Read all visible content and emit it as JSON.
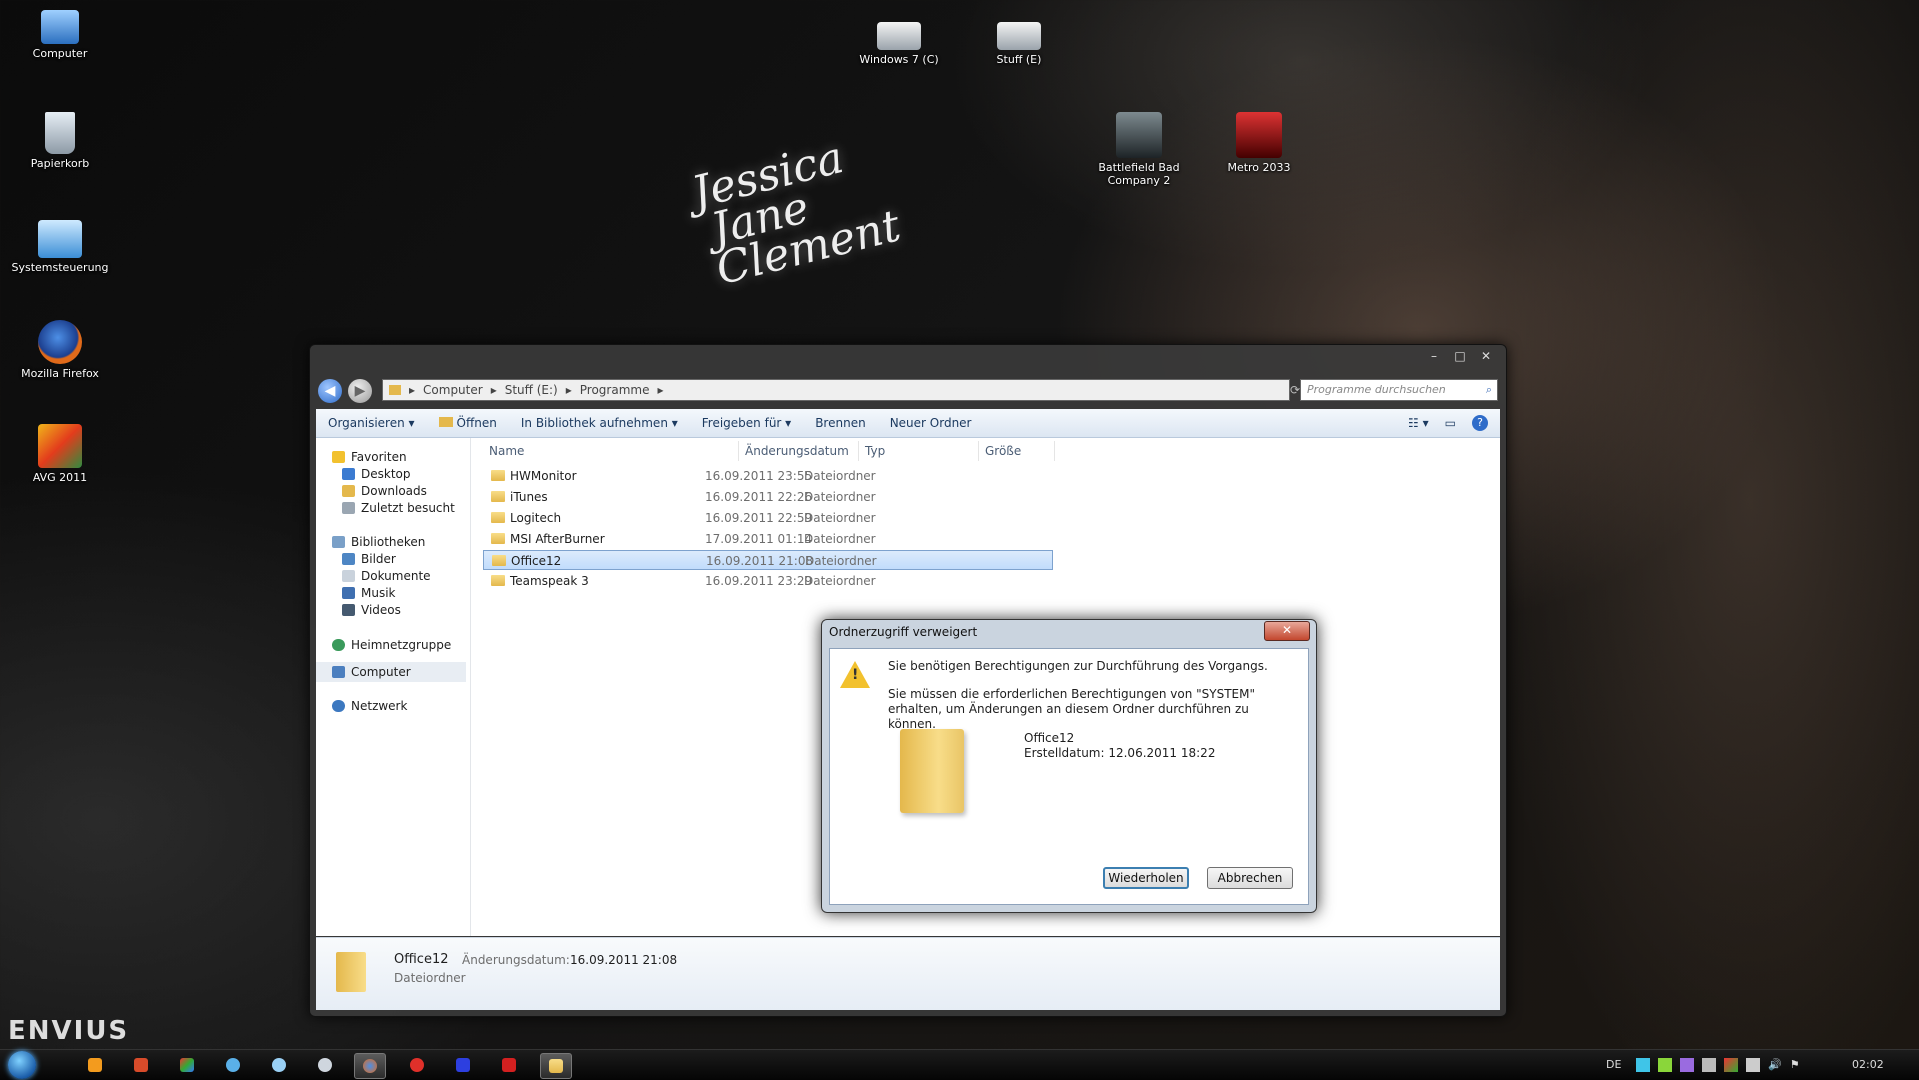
{
  "desktop": {
    "icons_left": [
      {
        "label": "Computer"
      },
      {
        "label": "Papierkorb"
      },
      {
        "label": "Systemsteuerung"
      },
      {
        "label": "Mozilla Firefox"
      },
      {
        "label": "AVG 2011"
      }
    ],
    "icons_top": [
      {
        "label": "Windows 7 (C)"
      },
      {
        "label": "Stuff (E)"
      }
    ],
    "icons_right": [
      {
        "label": "Battlefield Bad Company 2"
      },
      {
        "label": "Metro 2033"
      }
    ],
    "wallpaper_text": {
      "line1": "Jessica",
      "line2": "Jane",
      "line3": "Clement"
    },
    "brand": "ENVIUS"
  },
  "explorer": {
    "window_controls": {
      "minimize": "–",
      "maximize": "□",
      "close": "✕"
    },
    "address": {
      "part1": "Computer",
      "part2": "Stuff (E:)",
      "part3": "Programme",
      "sep": "▸"
    },
    "search": {
      "placeholder": "Programme durchsuchen"
    },
    "toolbar": {
      "organize": "Organisieren ▾",
      "open": "Öffnen",
      "library": "In Bibliothek aufnehmen ▾",
      "share": "Freigeben für ▾",
      "burn": "Brennen",
      "new_folder": "Neuer Ordner"
    },
    "sidebar": {
      "favorites": "Favoriten",
      "desktop": "Desktop",
      "downloads": "Downloads",
      "recent": "Zuletzt besucht",
      "libraries": "Bibliotheken",
      "pictures": "Bilder",
      "documents": "Dokumente",
      "music": "Musik",
      "videos": "Videos",
      "homegroup": "Heimnetzgruppe",
      "computer": "Computer",
      "network": "Netzwerk"
    },
    "columns": {
      "name": "Name",
      "date": "Änderungsdatum",
      "type": "Typ",
      "size": "Größe"
    },
    "rows": [
      {
        "name": "HWMonitor",
        "date": "16.09.2011 23:55",
        "type": "Dateiordner"
      },
      {
        "name": "iTunes",
        "date": "16.09.2011 22:26",
        "type": "Dateiordner"
      },
      {
        "name": "Logitech",
        "date": "16.09.2011 22:59",
        "type": "Dateiordner"
      },
      {
        "name": "MSI AfterBurner",
        "date": "17.09.2011 01:14",
        "type": "Dateiordner"
      },
      {
        "name": "Office12",
        "date": "16.09.2011 21:08",
        "type": "Dateiordner",
        "selected": true
      },
      {
        "name": "Teamspeak 3",
        "date": "16.09.2011 23:29",
        "type": "Dateiordner"
      }
    ],
    "details": {
      "name": "Office12",
      "modified_label": "Änderungsdatum:",
      "modified": "16.09.2011 21:08",
      "type": "Dateiordner"
    }
  },
  "dialog": {
    "title": "Ordnerzugriff verweigert",
    "close": "✕",
    "message1": "Sie benötigen Berechtigungen zur Durchführung des Vorgangs.",
    "message2": "Sie müssen die erforderlichen Berechtigungen von \"SYSTEM\" erhalten, um Änderungen an diesem Ordner durchführen zu können.",
    "folder_name": "Office12",
    "created": "Erstelldatum: 12.06.2011 18:22",
    "retry": "Wiederholen",
    "cancel": "Abbrechen"
  },
  "taskbar": {
    "language": "DE",
    "clock": "02:02"
  },
  "colors": {
    "accent": "#3c7fb1",
    "selection": "#c1dcfc",
    "warning": "#f2c12e"
  }
}
